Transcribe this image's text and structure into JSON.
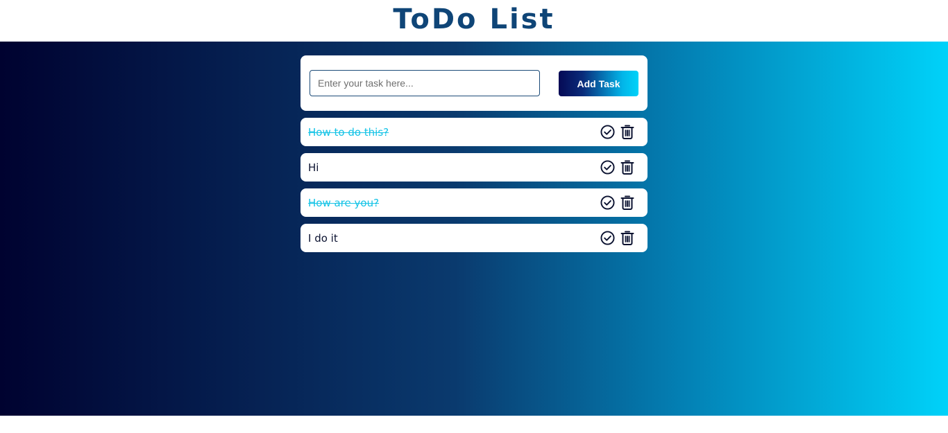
{
  "header": {
    "title": "ToDo List"
  },
  "form": {
    "placeholder": "Enter your task here...",
    "value": "",
    "add_label": "Add Task"
  },
  "colors": {
    "title": "#0f4577",
    "done_text": "#14c3e6",
    "gradient_start": "#000230",
    "gradient_end": "#00d2f9"
  },
  "tasks": [
    {
      "text": "How to do this?",
      "done": true,
      "check_icon": "check-circle-icon",
      "delete_icon": "trash-icon"
    },
    {
      "text": "Hi",
      "done": false,
      "check_icon": "check-circle-icon",
      "delete_icon": "trash-icon"
    },
    {
      "text": "How are you?",
      "done": true,
      "check_icon": "check-circle-icon",
      "delete_icon": "trash-icon"
    },
    {
      "text": "I do it",
      "done": false,
      "check_icon": "check-circle-icon",
      "delete_icon": "trash-icon"
    }
  ]
}
